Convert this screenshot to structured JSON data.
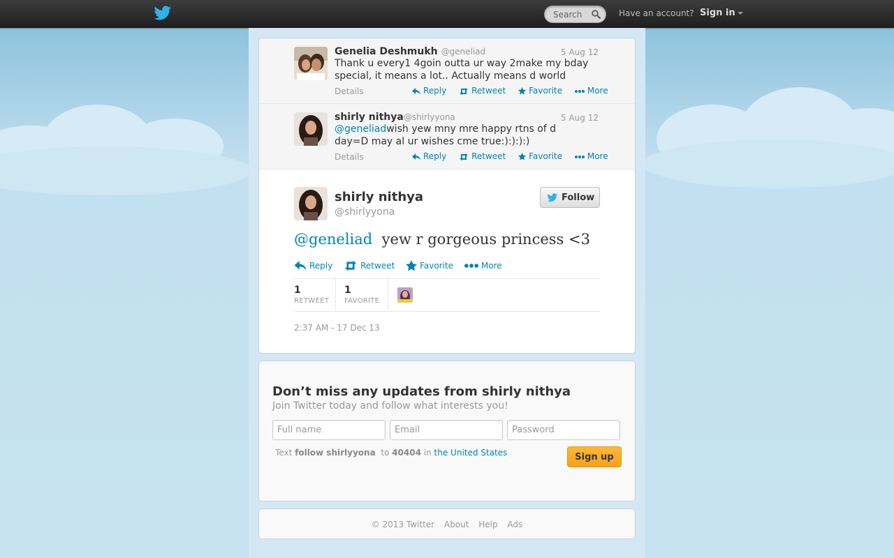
{
  "topbar": {
    "search_placeholder": "Search",
    "account_prompt": "Have an account?",
    "sign_in": "Sign in"
  },
  "context_tweets": [
    {
      "name": "Genelia Deshmukh",
      "handle": "@geneliad",
      "date": "5 Aug 12",
      "text": "Thank u every1 4goin outta ur way 2make my bday special, it means a lot.. Actually means d world",
      "details": "Details",
      "reply": "Reply",
      "retweet": "Retweet",
      "favorite": "Favorite",
      "more": "More"
    },
    {
      "name": "shirly nithya",
      "handle": "@shirlyyona",
      "date": "5 Aug 12",
      "mention": "@geneliad",
      "text": "wish yew mny mre happy rtns of d day=D may al ur wishes cme true:):):):)",
      "details": "Details",
      "reply": "Reply",
      "retweet": "Retweet",
      "favorite": "Favorite",
      "more": "More"
    }
  ],
  "main_tweet": {
    "name": "shirly nithya",
    "handle": "@shirlyyona",
    "follow": "Follow",
    "mention": "@geneliad",
    "text": "yew r gorgeous princess <3",
    "reply": "Reply",
    "retweet": "Retweet",
    "favorite": "Favorite",
    "more": "More",
    "retweet_count": "1",
    "retweet_label": "RETWEET",
    "favorite_count": "1",
    "favorite_label": "FAVORITE",
    "timestamp": "2:37 AM - 17 Dec 13"
  },
  "signup": {
    "title": "Don’t miss any updates from shirly nithya",
    "subtitle": "Join Twitter today and follow what interests you!",
    "fullname_placeholder": "Full name",
    "email_placeholder": "Email",
    "password_placeholder": "Password",
    "sms_text": "Text",
    "sms_command": "follow shirlyyona",
    "sms_to": "to",
    "sms_number": "40404",
    "sms_in": "in",
    "sms_country": "the United States",
    "button": "Sign up"
  },
  "footer": {
    "copyright": "© 2013 Twitter",
    "about": "About",
    "help": "Help",
    "ads": "Ads"
  },
  "colors": {
    "link": "#0084b4",
    "topbar": "#2b2b2b",
    "background": "#c0deed",
    "signup_button": "#f8a01a"
  }
}
